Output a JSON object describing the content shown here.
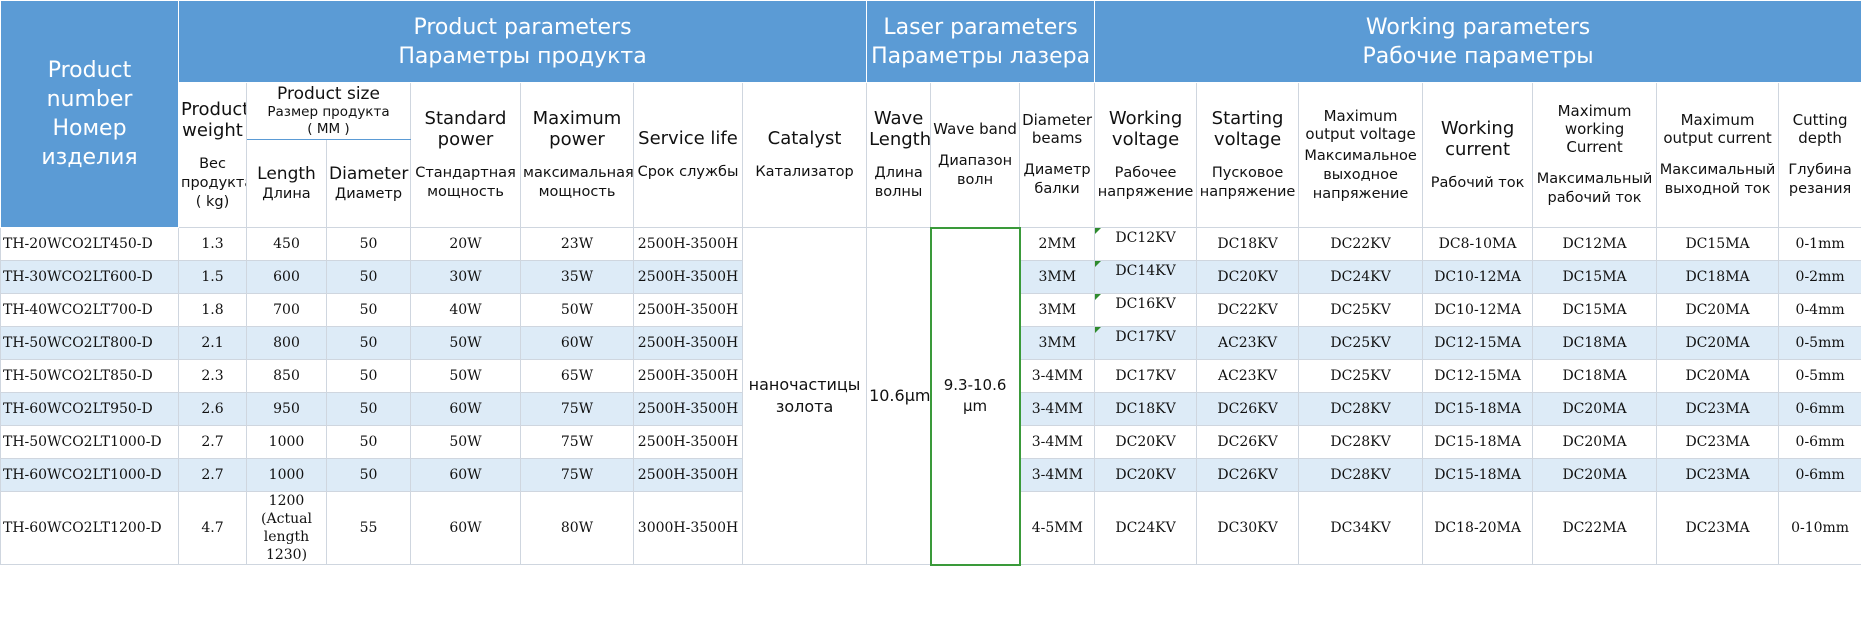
{
  "header": {
    "product_number": {
      "en": "Product number",
      "ru": "Номер изделия"
    },
    "groups": {
      "product": {
        "en": "Product parameters",
        "ru": "Параметры продукта"
      },
      "laser": {
        "en": "Laser parameters",
        "ru": "Параметры лазера"
      },
      "working": {
        "en": "Working parameters",
        "ru": "Рабочие параметры"
      }
    },
    "weight": {
      "en": "Product weight",
      "ru": "Вес продукта ( kg)"
    },
    "size": {
      "en": "Product size",
      "ru": "Размер продукта",
      "unit": "( MM )"
    },
    "length": {
      "en": "Length",
      "ru": "Длина"
    },
    "diameter": {
      "en": "Diameter",
      "ru": "Диаметр"
    },
    "standard_power": {
      "en": "Standard power",
      "ru": "Стандартная мощность"
    },
    "maximum_power": {
      "en": "Maximum power",
      "ru": "максимальная мощность"
    },
    "service_life": {
      "en": "Service life",
      "ru": "Срок службы"
    },
    "catalyst": {
      "en": "Catalyst",
      "ru": "Катализатор"
    },
    "wave_length": {
      "en": "Wave Length",
      "ru": "Длина волны"
    },
    "wave_band": {
      "en": "Wave band",
      "ru": "Диапазон волн"
    },
    "diameter_beams": {
      "en": "Diameter beams",
      "ru": "Диаметр балки"
    },
    "working_voltage": {
      "en": "Working voltage",
      "ru": "Рабочее напряжение"
    },
    "starting_voltage": {
      "en": "Starting voltage",
      "ru": "Пусковое напряжение"
    },
    "max_output_voltage": {
      "en": "Maximum output voltage",
      "ru": "Максимальное выходное напряжение"
    },
    "working_current": {
      "en": "Working current",
      "ru": "Рабочий ток"
    },
    "max_working_current": {
      "en": "Maximum working Current",
      "ru": "Максимальный рабочий ток"
    },
    "max_output_current": {
      "en": "Maximum output current",
      "ru": "Максимальный выходной ток"
    },
    "cutting_depth": {
      "en": "Cutting depth",
      "ru": "Глубина резания"
    }
  },
  "merged": {
    "catalyst": "наночастицы золота",
    "wave_length": "10.6μm",
    "wave_band": "9.3-10.6 μm"
  },
  "rows": [
    {
      "model": "TH-20WCO2LT450-D",
      "weight": "1.3",
      "length": "450",
      "diameter": "50",
      "std_power": "20W",
      "max_power": "23W",
      "life": "2500H-3500H",
      "beam": "2MM",
      "work_v": "DC12KV",
      "start_v": "DC18KV",
      "max_out_v": "DC22KV",
      "work_i": "DC8-10MA",
      "max_work_i": "DC12MA",
      "max_out_i": "DC15MA",
      "depth": "0-1mm"
    },
    {
      "model": "TH-30WCO2LT600-D",
      "weight": "1.5",
      "length": "600",
      "diameter": "50",
      "std_power": "30W",
      "max_power": "35W",
      "life": "2500H-3500H",
      "beam": "3MM",
      "work_v": "DC14KV",
      "start_v": "DC20KV",
      "max_out_v": "DC24KV",
      "work_i": "DC10-12MA",
      "max_work_i": "DC15MA",
      "max_out_i": "DC18MA",
      "depth": "0-2mm"
    },
    {
      "model": "TH-40WCO2LT700-D",
      "weight": "1.8",
      "length": "700",
      "diameter": "50",
      "std_power": "40W",
      "max_power": "50W",
      "life": "2500H-3500H",
      "beam": "3MM",
      "work_v": "DC16KV",
      "start_v": "DC22KV",
      "max_out_v": "DC25KV",
      "work_i": "DC10-12MA",
      "max_work_i": "DC15MA",
      "max_out_i": "DC20MA",
      "depth": "0-4mm"
    },
    {
      "model": "TH-50WCO2LT800-D",
      "weight": "2.1",
      "length": "800",
      "diameter": "50",
      "std_power": "50W",
      "max_power": "60W",
      "life": "2500H-3500H",
      "beam": "3MM",
      "work_v": "DC17KV",
      "start_v": "AC23KV",
      "max_out_v": "DC25KV",
      "work_i": "DC12-15MA",
      "max_work_i": "DC18MA",
      "max_out_i": "DC20MA",
      "depth": "0-5mm"
    },
    {
      "model": "TH-50WCO2LT850-D",
      "weight": "2.3",
      "length": "850",
      "diameter": "50",
      "std_power": "50W",
      "max_power": "65W",
      "life": "2500H-3500H",
      "beam": "3-4MM",
      "work_v": "DC17KV",
      "start_v": "AC23KV",
      "max_out_v": "DC25KV",
      "work_i": "DC12-15MA",
      "max_work_i": "DC18MA",
      "max_out_i": "DC20MA",
      "depth": "0-5mm"
    },
    {
      "model": "TH-60WCO2LT950-D",
      "weight": "2.6",
      "length": "950",
      "diameter": "50",
      "std_power": "60W",
      "max_power": "75W",
      "life": "2500H-3500H",
      "beam": "3-4MM",
      "work_v": "DC18KV",
      "start_v": "DC26KV",
      "max_out_v": "DC28KV",
      "work_i": "DC15-18MA",
      "max_work_i": "DC20MA",
      "max_out_i": "DC23MA",
      "depth": "0-6mm"
    },
    {
      "model": "TH-50WCO2LT1000-D",
      "weight": "2.7",
      "length": "1000",
      "diameter": "50",
      "std_power": "50W",
      "max_power": "75W",
      "life": "2500H-3500H",
      "beam": "3-4MM",
      "work_v": "DC20KV",
      "start_v": "DC26KV",
      "max_out_v": "DC28KV",
      "work_i": "DC15-18MA",
      "max_work_i": "DC20MA",
      "max_out_i": "DC23MA",
      "depth": "0-6mm"
    },
    {
      "model": "TH-60WCO2LT1000-D",
      "weight": "2.7",
      "length": "1000",
      "diameter": "50",
      "std_power": "60W",
      "max_power": "75W",
      "life": "2500H-3500H",
      "beam": "3-4MM",
      "work_v": "DC20KV",
      "start_v": "DC26KV",
      "max_out_v": "DC28KV",
      "work_i": "DC15-18MA",
      "max_work_i": "DC20MA",
      "max_out_i": "DC23MA",
      "depth": "0-6mm"
    },
    {
      "model": "TH-60WCO2LT1200-D",
      "weight": "4.7",
      "length": "1200 (Actual length 1230)",
      "diameter": "55",
      "std_power": "60W",
      "max_power": "80W",
      "life": "3000H-3500H",
      "beam": "4-5MM",
      "work_v": "DC24KV",
      "start_v": "DC30KV",
      "max_out_v": "DC34KV",
      "work_i": "DC18-20MA",
      "max_work_i": "DC22MA",
      "max_out_i": "DC23MA",
      "depth": "0-10mm"
    }
  ],
  "colors": {
    "header_blue": "#5b9bd5",
    "row_stripe": "#ddebf7",
    "band_border": "#3a9a3a",
    "corner_marker": "#2e8b2e"
  }
}
